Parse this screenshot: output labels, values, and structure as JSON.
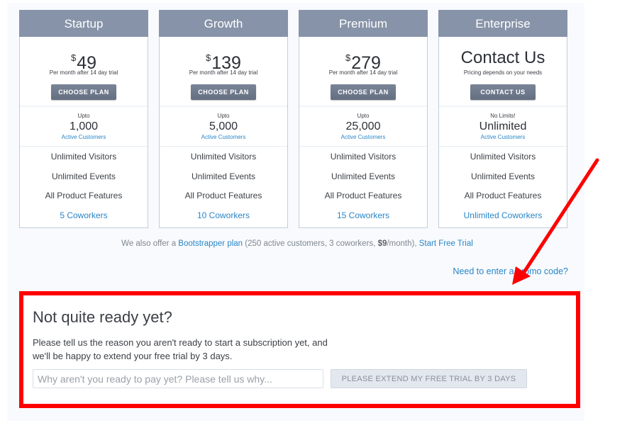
{
  "plans": [
    {
      "name": "Startup",
      "currency": "$",
      "price": "49",
      "price_note": "Per month after 14 day trial",
      "button": "CHOOSE PLAN",
      "customers_prefix": "Upto",
      "customers": "1,000",
      "customers_label": "Active Customers",
      "features": [
        "Unlimited Visitors",
        "Unlimited Events",
        "All Product Features"
      ],
      "coworkers": "5 Coworkers"
    },
    {
      "name": "Growth",
      "currency": "$",
      "price": "139",
      "price_note": "Per month after 14 day trial",
      "button": "CHOOSE PLAN",
      "customers_prefix": "Upto",
      "customers": "5,000",
      "customers_label": "Active Customers",
      "features": [
        "Unlimited Visitors",
        "Unlimited Events",
        "All Product Features"
      ],
      "coworkers": "10 Coworkers"
    },
    {
      "name": "Premium",
      "currency": "$",
      "price": "279",
      "price_note": "Per month after 14 day trial",
      "button": "CHOOSE PLAN",
      "customers_prefix": "Upto",
      "customers": "25,000",
      "customers_label": "Active Customers",
      "features": [
        "Unlimited Visitors",
        "Unlimited Events",
        "All Product Features"
      ],
      "coworkers": "15 Coworkers"
    },
    {
      "name": "Enterprise",
      "currency": "",
      "price": "Contact Us",
      "price_note": "Pricing depends on your needs",
      "button": "CONTACT US",
      "customers_prefix": "No Limits!",
      "customers": "Unlimited",
      "customers_label": "Active Customers",
      "features": [
        "Unlimited Visitors",
        "Unlimited Events",
        "All Product Features"
      ],
      "coworkers": "Unlimited Coworkers"
    }
  ],
  "bootstrap": {
    "prefix": "We also offer a ",
    "plan_link": "Bootstrapper plan",
    "details_1": " (250 active customers, 3 coworkers, ",
    "price": "$9",
    "details_2": "/month), ",
    "trial_link": "Start Free Trial"
  },
  "promo_link": "Need to enter a promo code?",
  "not_ready": {
    "title": "Not quite ready yet?",
    "text": "Please tell us the reason you aren't ready to start a subscription yet, and we'll be happy to extend your free trial by 3 days.",
    "input_value": "",
    "input_placeholder": "Why aren't you ready to pay yet? Please tell us why...",
    "button": "PLEASE EXTEND MY FREE TRIAL BY 3 DAYS"
  },
  "annotation": {
    "highlight_color": "#ff0000",
    "arrow_color": "#ff0000"
  }
}
